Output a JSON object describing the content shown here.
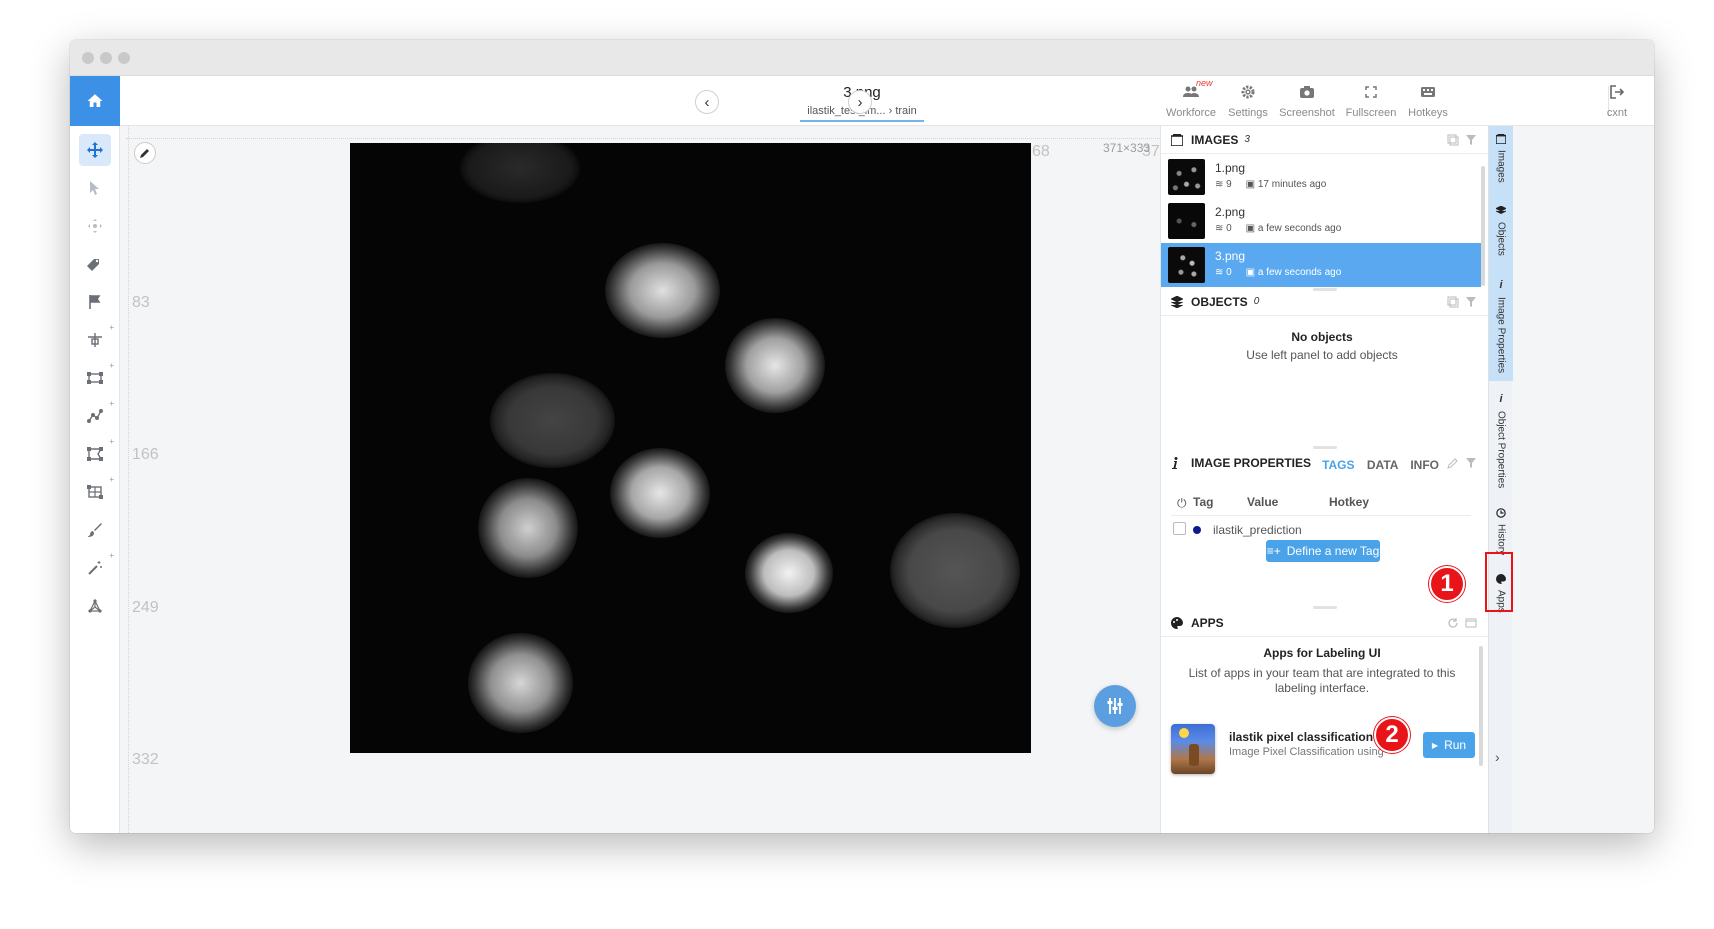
{
  "toolbar": {
    "image_name": "3.png",
    "breadcrumb_dataset": "ilastik_test_im...",
    "breadcrumb_separator": "›",
    "breadcrumb_project": "train",
    "new_badge": "new",
    "items": [
      {
        "label": "Workforce",
        "icon": "people-icon"
      },
      {
        "label": "Settings",
        "icon": "gear-icon"
      },
      {
        "label": "Screenshot",
        "icon": "camera-icon"
      },
      {
        "label": "Fullscreen",
        "icon": "fullscreen-icon"
      },
      {
        "label": "Hotkeys",
        "icon": "keyboard-icon"
      },
      {
        "label": "cxnt",
        "icon": "exit-icon"
      }
    ]
  },
  "canvas": {
    "ruler_left": [
      "83",
      "166",
      "249",
      "332"
    ],
    "ruler_top_partial": "68",
    "ruler_top_partial_2": "37",
    "size_label": "371×333"
  },
  "images_panel": {
    "title": "IMAGES",
    "count": "3",
    "items": [
      {
        "name": "1.png",
        "objects": "9",
        "time": "17 minutes ago"
      },
      {
        "name": "2.png",
        "objects": "0",
        "time": "a few seconds ago"
      },
      {
        "name": "3.png",
        "objects": "0",
        "time": "a few seconds ago"
      }
    ]
  },
  "objects_panel": {
    "title": "OBJECTS",
    "count": "0",
    "empty_title": "No objects",
    "empty_hint": "Use left panel to add objects"
  },
  "image_properties": {
    "title": "IMAGE PROPERTIES",
    "tabs": [
      "TAGS",
      "DATA",
      "INFO"
    ],
    "columns": [
      "Tag",
      "Value",
      "Hotkey"
    ],
    "tags": [
      {
        "name": "ilastik_prediction",
        "color": "#0d1b8c"
      }
    ],
    "define_button": "Define a new Tag"
  },
  "apps_panel": {
    "title": "APPS",
    "heading": "Apps for Labeling UI",
    "description": "List of apps in your team that are integrated to this labeling interface.",
    "app_name": "ilastik pixel classification",
    "app_desc": "Image Pixel Classification using",
    "run_label": "Run"
  },
  "side_tabs": [
    "Images",
    "Objects",
    "Image Properties",
    "Object Properties",
    "History",
    "Apps"
  ],
  "callouts": [
    "1",
    "2"
  ],
  "colors": {
    "accent": "#3c91e6",
    "selected_row": "#5aa9f0",
    "callout": "#e8141a"
  }
}
